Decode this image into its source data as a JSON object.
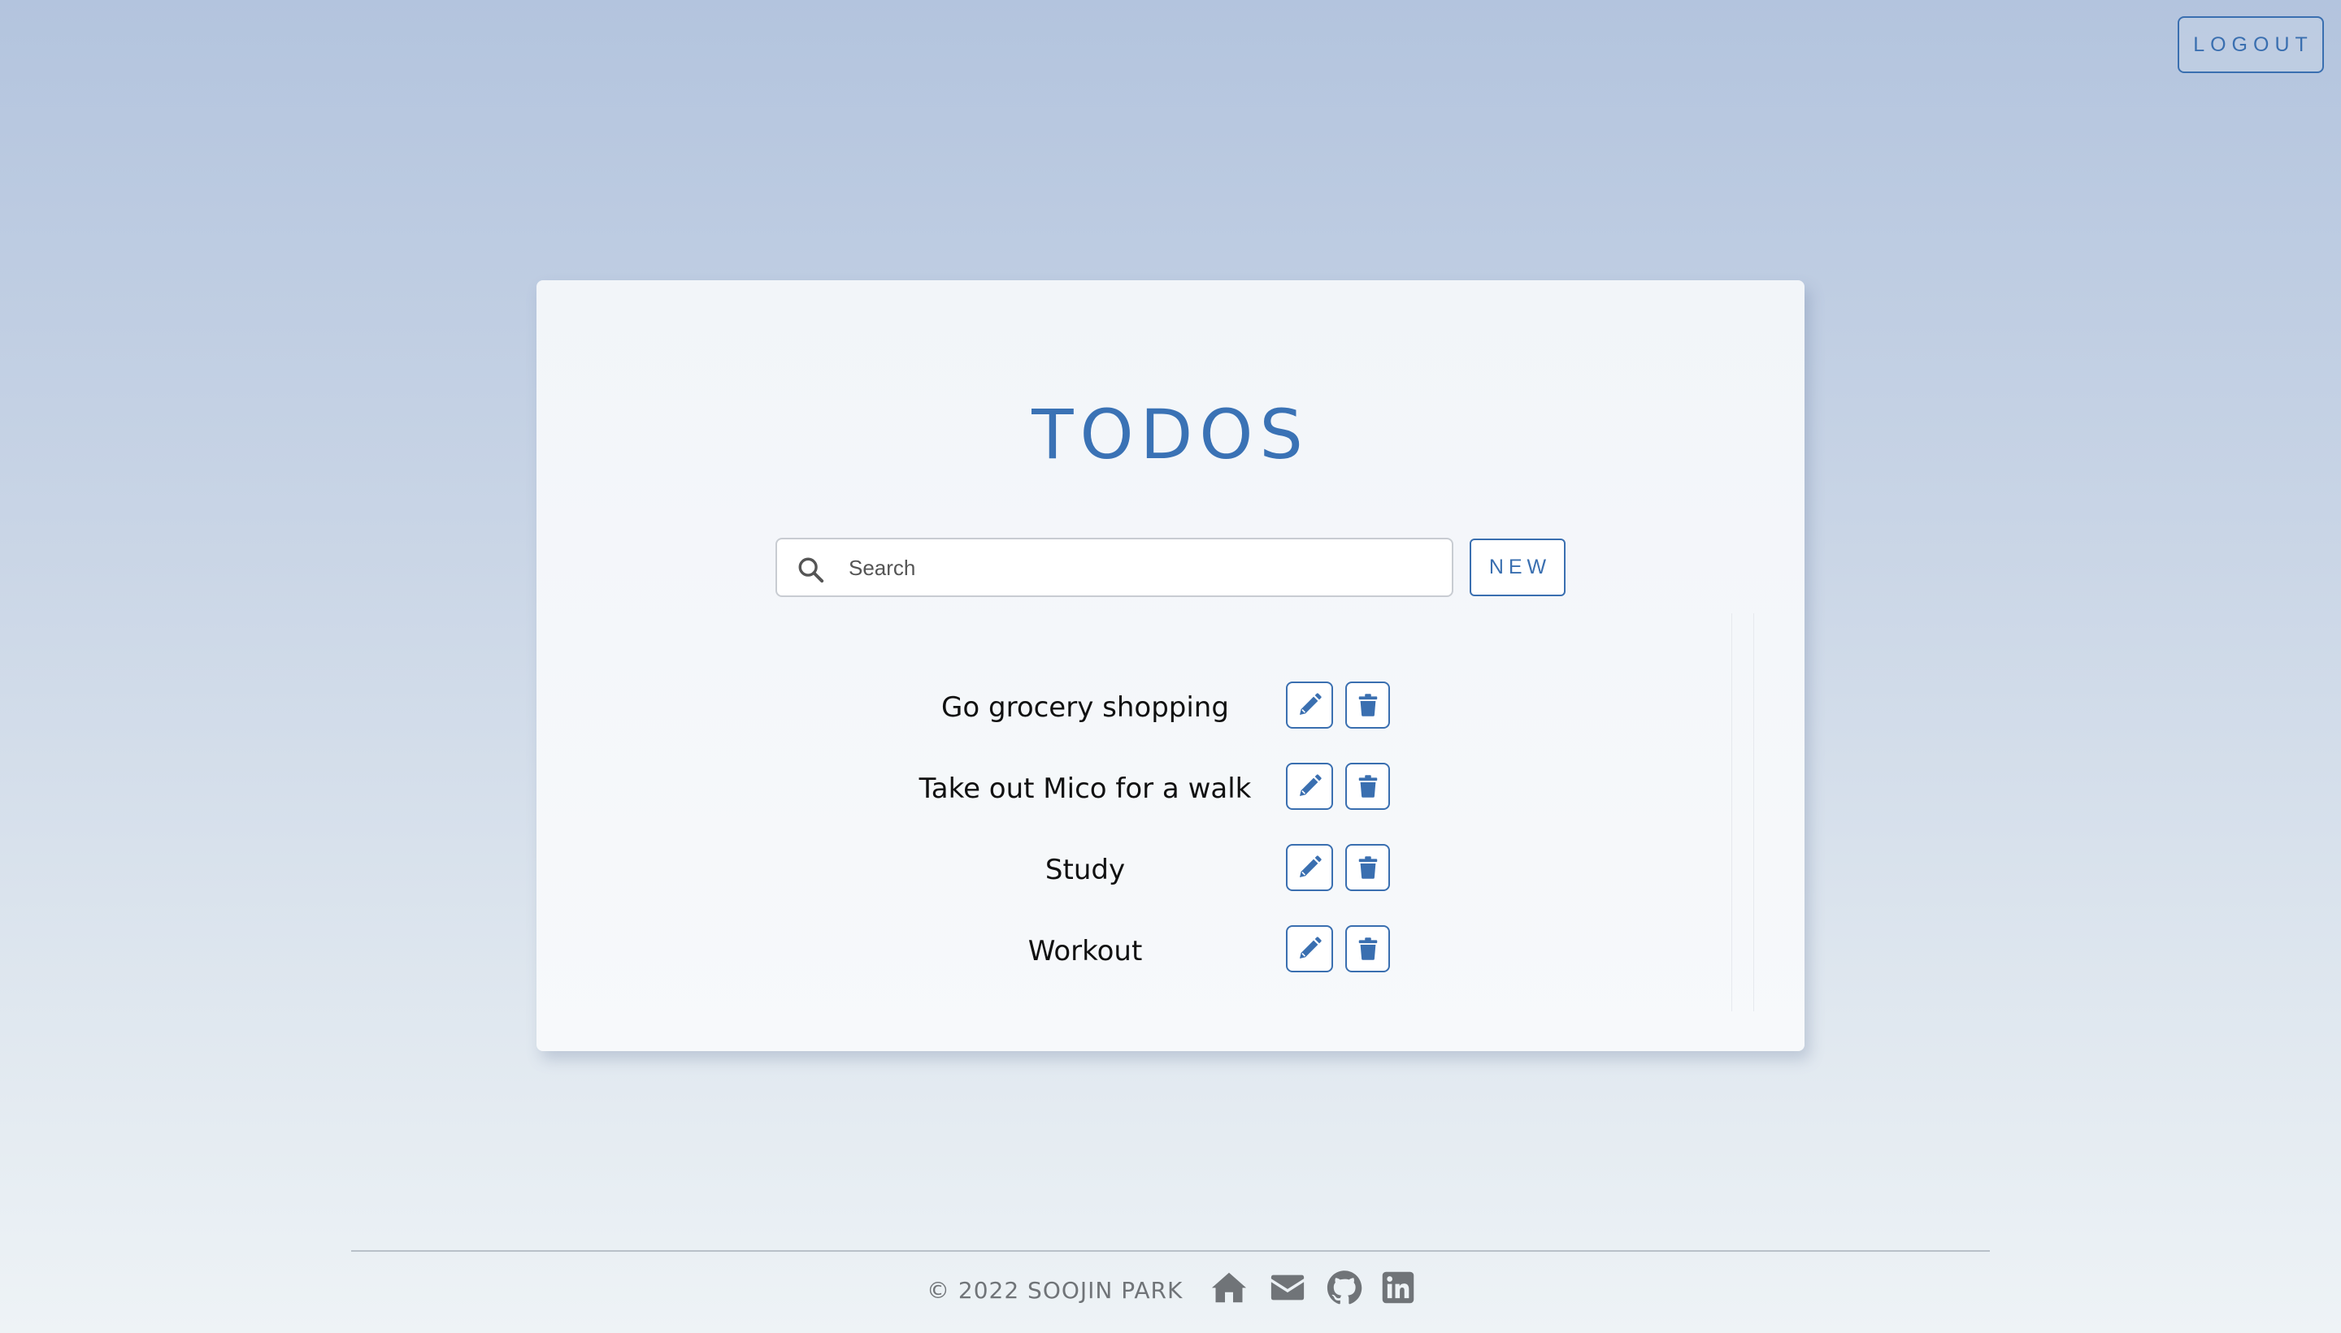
{
  "header": {
    "logout_label": "LOGOUT"
  },
  "main": {
    "title": "TODOS",
    "search": {
      "placeholder": "Search",
      "value": ""
    },
    "new_label": "NEW",
    "todos": [
      {
        "text": "Go grocery shopping"
      },
      {
        "text": "Take out Mico for a walk"
      },
      {
        "text": "Study"
      },
      {
        "text": "Workout"
      }
    ],
    "row_actions": {
      "edit_icon": "pencil-icon",
      "delete_icon": "trash-icon"
    }
  },
  "footer": {
    "copyright": "© 2022 SOOJIN PARK",
    "links": [
      {
        "icon": "home-icon"
      },
      {
        "icon": "envelope-icon"
      },
      {
        "icon": "github-icon"
      },
      {
        "icon": "linkedin-icon"
      }
    ]
  },
  "colors": {
    "accent": "#3a72b5",
    "footer_icon": "#707478"
  }
}
